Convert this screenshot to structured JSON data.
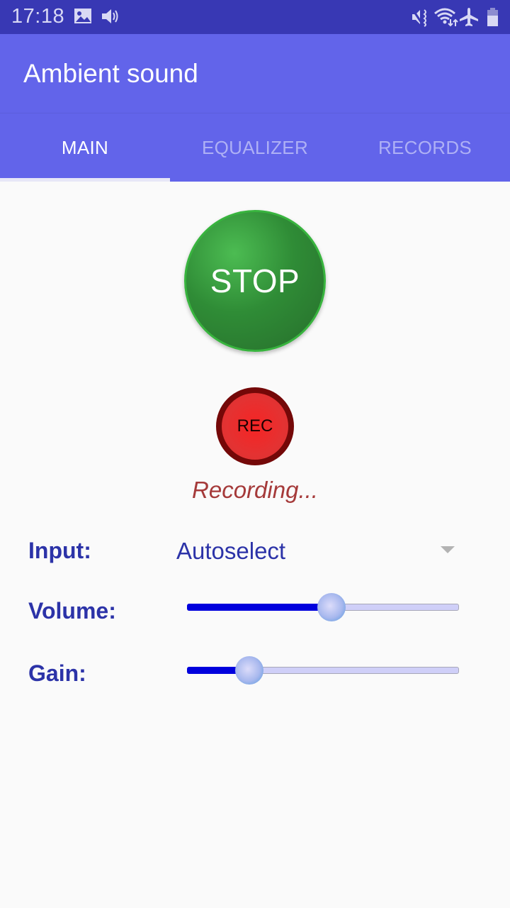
{
  "status_bar": {
    "time": "17:18",
    "left_icons": [
      "image-icon",
      "volume-icon"
    ],
    "right_icons": [
      "vibrate-mute-icon",
      "wifi-icon",
      "airplane-icon",
      "battery-icon"
    ]
  },
  "app_bar": {
    "title": "Ambient sound"
  },
  "tabs": [
    {
      "label": "MAIN",
      "active": true
    },
    {
      "label": "EQUALIZER",
      "active": false
    },
    {
      "label": "RECORDS",
      "active": false
    }
  ],
  "main": {
    "stop_button": {
      "label": "STOP"
    },
    "rec_button": {
      "label": "REC"
    },
    "rec_status": "Recording...",
    "input": {
      "label": "Input:",
      "value": "Autoselect"
    },
    "volume": {
      "label": "Volume:",
      "value": 0.53
    },
    "gain": {
      "label": "Gain:",
      "value": 0.23
    }
  },
  "colors": {
    "status_bar": "#3838b4",
    "primary": "#6264ea",
    "label_text": "#2c33a8",
    "stop_green": "#2f8c36",
    "rec_red": "#e43232",
    "recording_text": "#a53a3a",
    "slider_fill": "#0000dd"
  }
}
